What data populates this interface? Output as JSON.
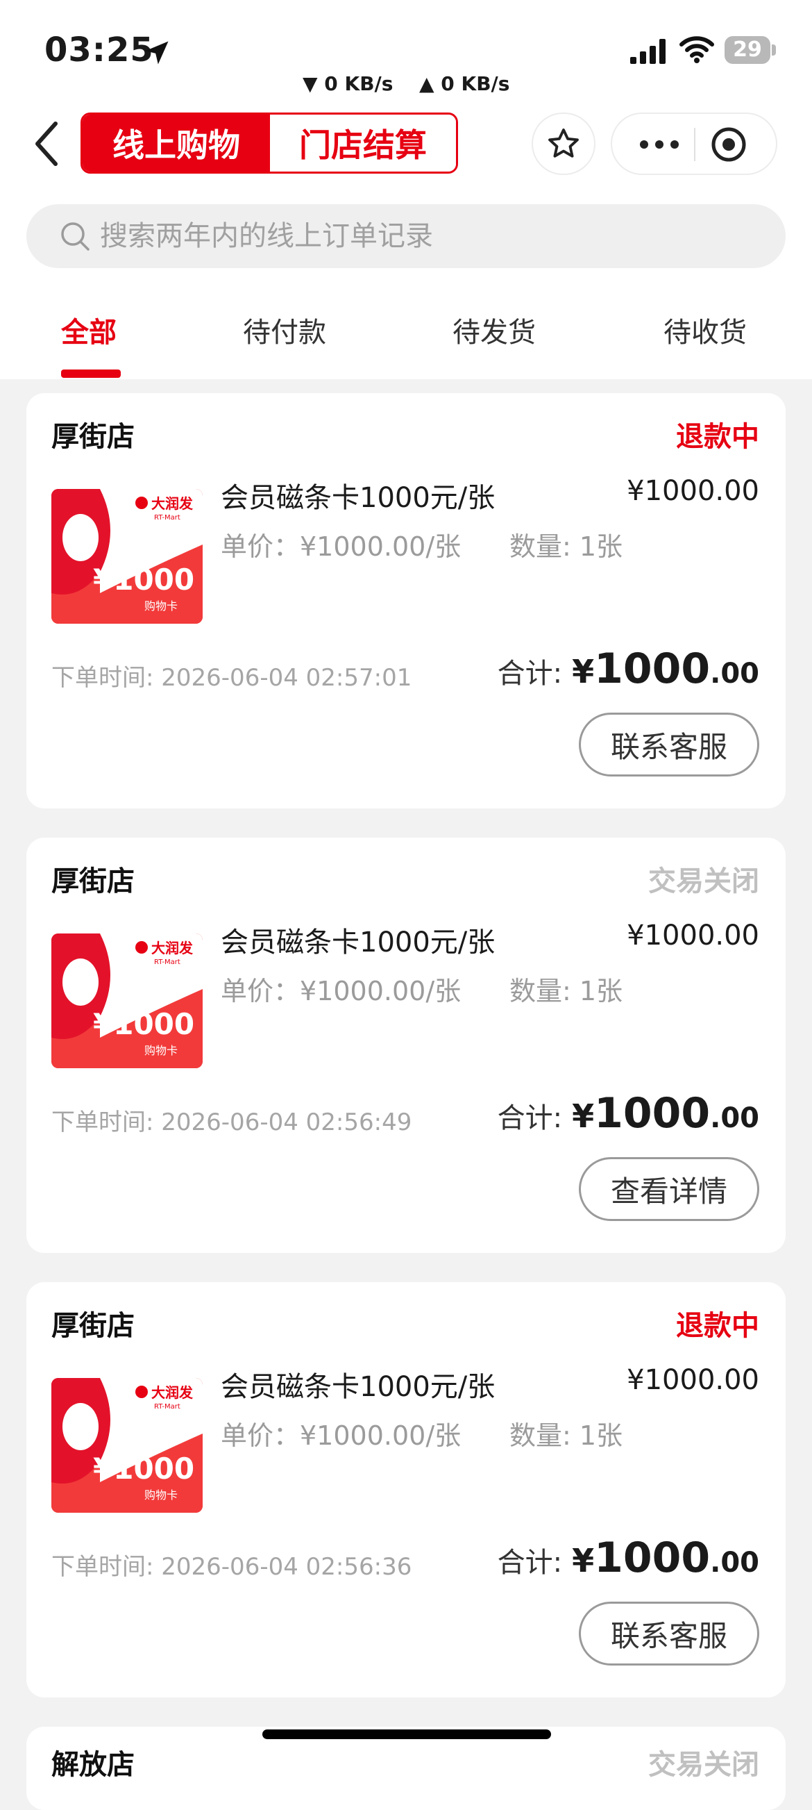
{
  "status_bar": {
    "time": "03:25",
    "battery": "29",
    "down_speed": "▼ 0 KB/s",
    "up_speed": "▲ 0 KB/s"
  },
  "nav": {
    "segment_online": "线上购物",
    "segment_store": "门店结算"
  },
  "search": {
    "placeholder": "搜索两年内的线上订单记录"
  },
  "tabs": [
    "全部",
    "待付款",
    "待发货",
    "待收货"
  ],
  "card_image_text": {
    "brand": "大润发",
    "brand_en": "RT-Mart",
    "amount": "¥1000",
    "label": "购物卡"
  },
  "orders": [
    {
      "store": "厚街店",
      "status": "退款中",
      "status_color": "#e60012",
      "product": "会员磁条卡1000元/张",
      "price": "¥1000.00",
      "unit_price": "单价：¥1000.00/张",
      "quantity": "数量: 1张",
      "order_time": "下单时间: 2026-06-04 02:57:01",
      "total_label": "合计:",
      "total_currency": "¥",
      "total_int": "1000",
      "total_dec": ".00",
      "action": "联系客服"
    },
    {
      "store": "厚街店",
      "status": "交易关闭",
      "status_color": "#c0c0c0",
      "product": "会员磁条卡1000元/张",
      "price": "¥1000.00",
      "unit_price": "单价：¥1000.00/张",
      "quantity": "数量: 1张",
      "order_time": "下单时间: 2026-06-04 02:56:49",
      "total_label": "合计:",
      "total_currency": "¥",
      "total_int": "1000",
      "total_dec": ".00",
      "action": "查看详情"
    },
    {
      "store": "厚街店",
      "status": "退款中",
      "status_color": "#e60012",
      "product": "会员磁条卡1000元/张",
      "price": "¥1000.00",
      "unit_price": "单价：¥1000.00/张",
      "quantity": "数量: 1张",
      "order_time": "下单时间: 2026-06-04 02:56:36",
      "total_label": "合计:",
      "total_currency": "¥",
      "total_int": "1000",
      "total_dec": ".00",
      "action": "联系客服"
    }
  ],
  "partial_order": {
    "store": "解放店",
    "status": "交易关闭"
  },
  "colors": {
    "accent": "#e60012",
    "background": "#f2f2f2"
  }
}
